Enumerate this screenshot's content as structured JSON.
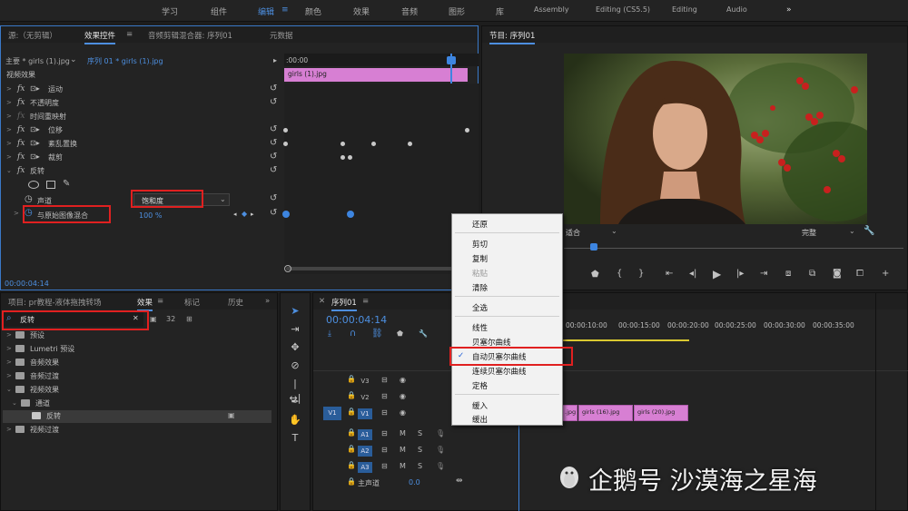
{
  "workspaces": [
    "学习",
    "组件",
    "编辑",
    "颜色",
    "效果",
    "音频",
    "图形",
    "库",
    "Assembly",
    "Editing (CS5.5)",
    "Editing",
    "Audio"
  ],
  "workspace_active": "编辑",
  "workspace_more": "»",
  "effect_controls": {
    "tabs": [
      "源:（无剪辑）",
      "效果控件",
      "音频剪辑混合器: 序列01",
      "元数据"
    ],
    "menu_icon": "≡",
    "master": "主要 * girls (1).jpg",
    "sequence": "序列 01 * girls (1).jpg",
    "ruler_time": ":00:00",
    "clip_name": "girls (1).jpg",
    "section": "视频效果",
    "rows": [
      "运动",
      "不透明度",
      "时间重映射",
      "位移",
      "紊乱置换",
      "裁剪",
      "反转"
    ],
    "channel_label": "声道",
    "channel_value": "饱和度",
    "blend_label": "与原始图像混合",
    "blend_value": "100 %",
    "timecode": "00:00:04:14"
  },
  "program": {
    "title": "节目: 序列01",
    "fit": "适合",
    "quality": "完整"
  },
  "project": {
    "tabs": [
      "项目: pr教程-液体拖拽转场",
      "效果",
      "标记",
      "历史"
    ],
    "search_value": "反转",
    "tree": [
      "预设",
      "Lumetri 预设",
      "音频效果",
      "音频过渡",
      "视频效果",
      "通道",
      "反转",
      "视频过渡"
    ]
  },
  "timeline": {
    "title": "序列01",
    "timecode": "00:00:04:14",
    "ruler": [
      "00:00:10:00",
      "00:00:15:00",
      "00:00:20:00",
      "00:00:25:00",
      "00:00:30:00",
      "00:00:35:00"
    ],
    "tracks": [
      "V3",
      "V2",
      "V1",
      "A1",
      "A2",
      "A3"
    ],
    "source_v": "V1",
    "master": "主声道",
    "master_value": "0.0",
    "clips": [
      ".jpg",
      "girls (16).jpg",
      "girls (20).jpg"
    ]
  },
  "context_menu": {
    "items": [
      "还原",
      "剪切",
      "复制",
      "粘贴",
      "清除",
      "全选",
      "线性",
      "贝塞尔曲线",
      "自动贝塞尔曲线",
      "连续贝塞尔曲线",
      "定格",
      "缓入",
      "缓出"
    ],
    "checked": "自动贝塞尔曲线",
    "check_mark": "✓"
  },
  "watermark": "企鹅号 沙漠海之星海",
  "colors": {
    "accent": "#4d8fe0",
    "highlight_box": "#e02020",
    "clip": "#d77fd3",
    "playhead": "#3d85e0"
  }
}
